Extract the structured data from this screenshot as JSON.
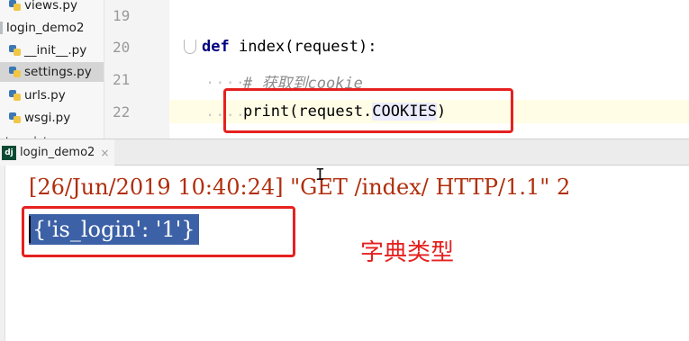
{
  "project_tree": {
    "items": [
      {
        "label": "views.py",
        "icon": "python-file-icon"
      },
      {
        "label": "login_demo2",
        "icon": "folder-icon"
      },
      {
        "label": "__init__.py",
        "icon": "python-file-icon"
      },
      {
        "label": "settings.py",
        "icon": "python-file-icon",
        "selected": true
      },
      {
        "label": "urls.py",
        "icon": "python-file-icon"
      },
      {
        "label": "wsgi.py",
        "icon": "python-file-icon"
      },
      {
        "label": "templates",
        "icon": "folder-icon"
      }
    ]
  },
  "editor": {
    "lines": [
      {
        "number": "19",
        "code": ""
      },
      {
        "number": "20",
        "keyword": "def",
        "code": " index(request):"
      },
      {
        "number": "21",
        "comment": "# 获取到cookie"
      },
      {
        "number": "22",
        "code_before": "print(request.",
        "highlight": "COOKIES",
        "code_after": ")"
      }
    ]
  },
  "run_panel": {
    "tab_label": "login_demo2",
    "tab_icon_text": "dj",
    "close_glyph": "×"
  },
  "console": {
    "log_line": "[26/Jun/2019 10:40:24] \"GET /index/ HTTP/1.1\" 2",
    "cookie_output": "{'is_login': '1'}"
  },
  "annotation": {
    "text": "字典类型",
    "color": "#e5211f"
  },
  "colors": {
    "keyword": "#000080",
    "comment": "#8c8c8c",
    "console_text": "#b02e0c",
    "selection": "#3c61a6"
  }
}
